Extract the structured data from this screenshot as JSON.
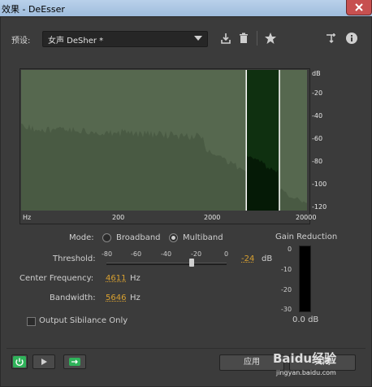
{
  "window": {
    "title": "效果 - DeEsser"
  },
  "preset": {
    "label": "预设:",
    "value": "女声 DeSher *"
  },
  "toolbar": {
    "icons": [
      "save-preset-icon",
      "delete-preset-icon",
      "favorite-star-icon",
      "routing-icon",
      "info-icon"
    ]
  },
  "graph": {
    "x_ticks": [
      "Hz",
      "200",
      "2000",
      "20000"
    ],
    "y_ticks": [
      "dB",
      "-20",
      "-40",
      "-60",
      "-80",
      "-100",
      "-120"
    ],
    "band_hz": [
      4611,
      10257
    ],
    "colors": {
      "background": "#56684f",
      "band": "#0f3010",
      "spectrum": "#3f4e3a"
    }
  },
  "mode": {
    "label": "Mode:",
    "options": [
      "Broadband",
      "Multiband"
    ],
    "selected": "Multiband"
  },
  "threshold": {
    "label": "Threshold:",
    "scale": [
      "-80",
      "-60",
      "-40",
      "-20",
      "0"
    ],
    "value": "-24",
    "unit": "dB"
  },
  "center_frequency": {
    "label": "Center Frequency:",
    "value": "4611",
    "unit": "Hz"
  },
  "bandwidth": {
    "label": "Bandwidth:",
    "value": "5646",
    "unit": "Hz"
  },
  "output_sibilance": {
    "label": "Output Sibilance Only",
    "checked": false
  },
  "gain_reduction": {
    "label": "Gain Reduction",
    "ticks": [
      "0",
      "-10",
      "-20",
      "-30"
    ],
    "value": "0.0 dB"
  },
  "buttons": {
    "apply": "应用",
    "close": "关闭"
  },
  "watermark": {
    "text": "Baidu经验",
    "url": "jingyan.baidu.com"
  },
  "colors": {
    "accent_value": "#d8a030",
    "power_on": "#2fb35a",
    "titlebar": "#b9d1ea",
    "close": "#c75050"
  }
}
